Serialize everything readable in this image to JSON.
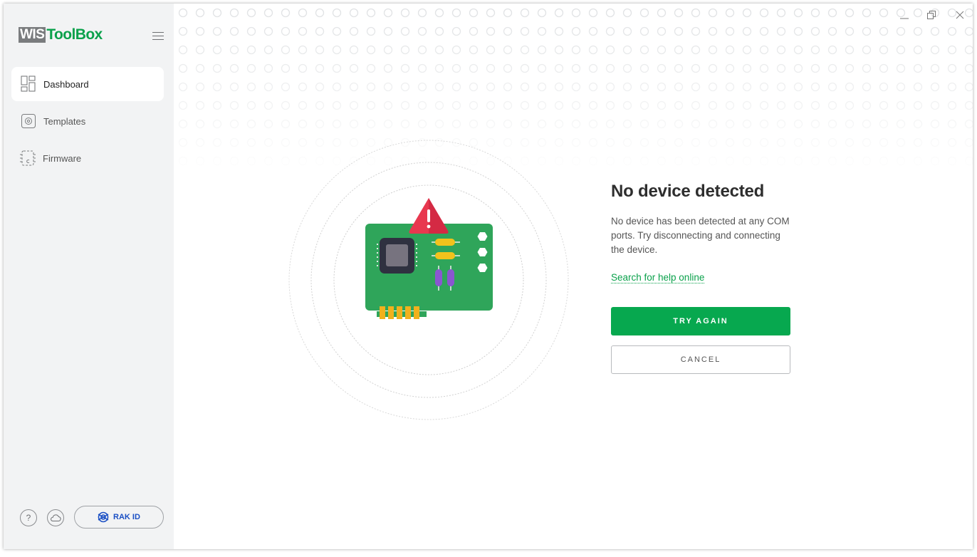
{
  "app": {
    "logo_part1": "WIS",
    "logo_part2": "ToolBox"
  },
  "sidebar": {
    "items": [
      {
        "label": "Dashboard",
        "icon": "dashboard-icon",
        "active": true
      },
      {
        "label": "Templates",
        "icon": "templates-icon",
        "active": false
      },
      {
        "label": "Firmware",
        "icon": "firmware-icon",
        "active": false
      }
    ],
    "help_symbol": "?",
    "rak_label": "RAK ID"
  },
  "main": {
    "title": "No device detected",
    "description": "No device has been detected at any COM ports. Try disconnecting and connecting the device.",
    "help_link": "Search for help online",
    "try_again": "TRY AGAIN",
    "cancel": "CANCEL"
  },
  "colors": {
    "accent": "#07a84f",
    "brand_green": "#0aa14b",
    "warning": "#e8384f",
    "rak_blue": "#1a4fc4",
    "sidebar_bg": "#f2f3f4"
  }
}
